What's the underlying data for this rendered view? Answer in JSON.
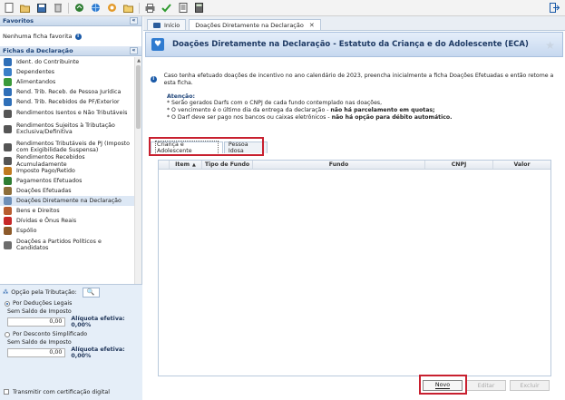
{
  "toolbar": {
    "icons": [
      "new-file-icon",
      "open-folder-icon",
      "save-icon",
      "delete-icon",
      "import-icon",
      "globe-icon",
      "restore-icon",
      "folder-icon",
      "print-icon",
      "check-icon",
      "document-icon",
      "calculator-icon",
      "exit-icon"
    ]
  },
  "favoritos": {
    "title": "Favoritos",
    "empty_text": "Nenhuma ficha favorita"
  },
  "fichas": {
    "title": "Fichas da Declaração",
    "items": [
      {
        "label": "Ident. do Contribuinte",
        "icon": "person-card-icon",
        "color": "#2f6fb8"
      },
      {
        "label": "Dependentes",
        "icon": "people-icon",
        "color": "#3a7fc8"
      },
      {
        "label": "Alimentandos",
        "icon": "people-green-icon",
        "color": "#3a9a3a"
      },
      {
        "label": "Rend. Trib. Receb. de Pessoa Jurídica",
        "icon": "building-icon",
        "color": "#2f6fb8"
      },
      {
        "label": "Rend. Trib. Recebidos de PF/Exterior",
        "icon": "globe-person-icon",
        "color": "#2f6fb8"
      },
      {
        "label": "Rendimentos Isentos e Não Tributáveis",
        "icon": "money-icon",
        "color": "#555555"
      },
      {
        "label": "Rendimentos Sujeitos à Tributação Exclusiva/Definitiva",
        "icon": "money-stack-icon",
        "color": "#555555"
      },
      {
        "label": "Rendimentos Tributáveis de PJ (Imposto com Exigibilidade Suspensa)",
        "icon": "money-stack-icon",
        "color": "#555555"
      },
      {
        "label": "Rendimentos Recebidos Acumuladamente",
        "icon": "money-stack-icon",
        "color": "#555555"
      },
      {
        "label": "Imposto Pago/Retido",
        "icon": "receipt-icon",
        "color": "#c07a20"
      },
      {
        "label": "Pagamentos Efetuados",
        "icon": "card-icon",
        "color": "#2e7d32"
      },
      {
        "label": "Doações Efetuadas",
        "icon": "gift-icon",
        "color": "#8d6e3a"
      },
      {
        "label": "Doações Diretamente na Declaração",
        "icon": "donation-icon",
        "color": "#6d8fb8",
        "selected": true
      },
      {
        "label": "Bens e Direitos",
        "icon": "house-icon",
        "color": "#b85c2f"
      },
      {
        "label": "Dívidas e Ônus Reais",
        "icon": "down-arrow-icon",
        "color": "#c62828"
      },
      {
        "label": "Espólio",
        "icon": "briefcase-icon",
        "color": "#8d5a2a"
      },
      {
        "label": "Doações a Partidos Políticos e Candidatos",
        "icon": "flag-icon",
        "color": "#6d6d6d"
      }
    ]
  },
  "opcao": {
    "title": "Opção pela Tributação:",
    "deducoes_label": "Por Deduções Legais",
    "deducoes_sub": "Sem Saldo de Imposto",
    "deducoes_value": "0,00",
    "deducoes_aliquota": "Alíquota efetiva: 0,00%",
    "simplificado_label": "Por Desconto Simplificado",
    "simplificado_sub": "Sem Saldo de Imposto",
    "simplificado_value": "0,00",
    "simplificado_aliquota": "Alíquota efetiva: 0,00%",
    "certificado_label": "Transmitir com certificação digital"
  },
  "tabs": [
    {
      "label": "Início"
    },
    {
      "label": "Doações Diretamente na Declaração"
    }
  ],
  "page": {
    "title": "Doações Diretamente na Declaração - Estatuto da Criança e do Adolescente (ECA)",
    "info": "Caso tenha efetuado doações de incentivo no ano calendário de 2023, preencha inicialmente a ficha Doações Efetuadas e então retome a esta ficha.",
    "atencao": "Atenção:",
    "bullet1": "* Serão gerados Darfs com o CNPJ de cada fundo contemplado nas doações,",
    "bullet2_pre": "* O vencimento é o último dia da entrega da declaração - ",
    "bullet2_bold": "não há parcelamento em quotas;",
    "bullet3_pre": "* O Darf deve ser pago nos bancos ou caixas eletrônicos - ",
    "bullet3_bold": "não há opção para débito automático."
  },
  "subtabs": [
    {
      "label": "Criança e Adolescente"
    },
    {
      "label": "Pessoa Idosa"
    }
  ],
  "grid": {
    "columns": [
      "",
      "Item",
      "Tipo de Fundo",
      "Fundo",
      "CNPJ",
      "Valor"
    ]
  },
  "buttons": {
    "novo": "Novo",
    "editar": "Editar",
    "excluir": "Excluir"
  }
}
